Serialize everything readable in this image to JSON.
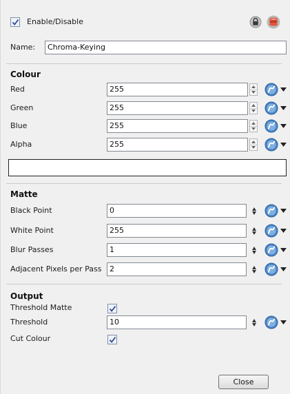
{
  "header": {
    "enable_label": "Enable/Disable",
    "enable_checked": true,
    "icons": [
      "lock-icon",
      "layer-stack-icon"
    ]
  },
  "name": {
    "label": "Name:",
    "value": "Chroma-Keying"
  },
  "colour": {
    "title": "Colour",
    "rows": [
      {
        "label": "Red",
        "value": "255"
      },
      {
        "label": "Green",
        "value": "255"
      },
      {
        "label": "Blue",
        "value": "255"
      },
      {
        "label": "Alpha",
        "value": "255"
      }
    ],
    "swatch_color": "#ffffff"
  },
  "matte": {
    "title": "Matte",
    "rows": [
      {
        "label": "Black Point",
        "value": "0"
      },
      {
        "label": "White Point",
        "value": "255"
      },
      {
        "label": "Blur Passes",
        "value": "1"
      },
      {
        "label": "Adjacent Pixels per Pass",
        "value": "2"
      }
    ]
  },
  "output": {
    "title": "Output",
    "threshold_matte_label": "Threshold Matte",
    "threshold_matte_checked": true,
    "threshold_label": "Threshold",
    "threshold_value": "10",
    "cut_colour_label": "Cut Colour",
    "cut_colour_checked": true
  },
  "footer": {
    "close_label": "Close"
  }
}
